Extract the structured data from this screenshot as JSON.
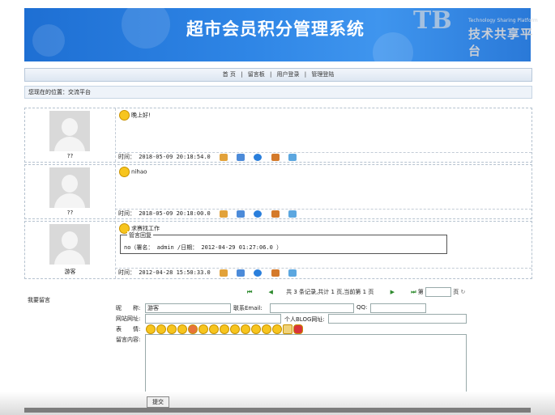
{
  "banner": {
    "title": "超市会员积分管理系统",
    "logo_big": "TB",
    "logo_cn": "技术共享平台",
    "logo_en": "Technology Sharing Platform"
  },
  "nav": {
    "items": [
      "首 页",
      "留言板",
      "用户登录",
      "管理登陆"
    ],
    "sep": "|"
  },
  "location": {
    "text": "您现在的位置：交流平台"
  },
  "messages": [
    {
      "user": "??",
      "text": "晚上好!",
      "time": "时间： 2018-05-09 20:18:54.0",
      "reply": null
    },
    {
      "user": "??",
      "text": "nihao",
      "time": "时间： 2018-05-09 20:18:00.0",
      "reply": null
    },
    {
      "user": "游客",
      "text": "求赛找工作",
      "time": "时间： 2012-04-28 15:50:33.0",
      "reply": {
        "legend": "管言回复",
        "text": "no（署名： admin /日期： 2012-04-29 01:27:06.0 ）"
      }
    }
  ],
  "pager": {
    "text": "共 3 条记录,共计 1 页,当前第 1 页",
    "go_label": "第",
    "page_label": "页"
  },
  "form": {
    "section_label": "我要留言",
    "nickname_label": "昵　　称:",
    "nickname_value": "游客",
    "email_label": "联系Email:",
    "qq_label": "QQ:",
    "website_label": "网站网址:",
    "blog_label": "个人BLOG网址:",
    "expression_label": "表　　情:",
    "content_label": "留言内容:",
    "submit_label": "提交"
  }
}
